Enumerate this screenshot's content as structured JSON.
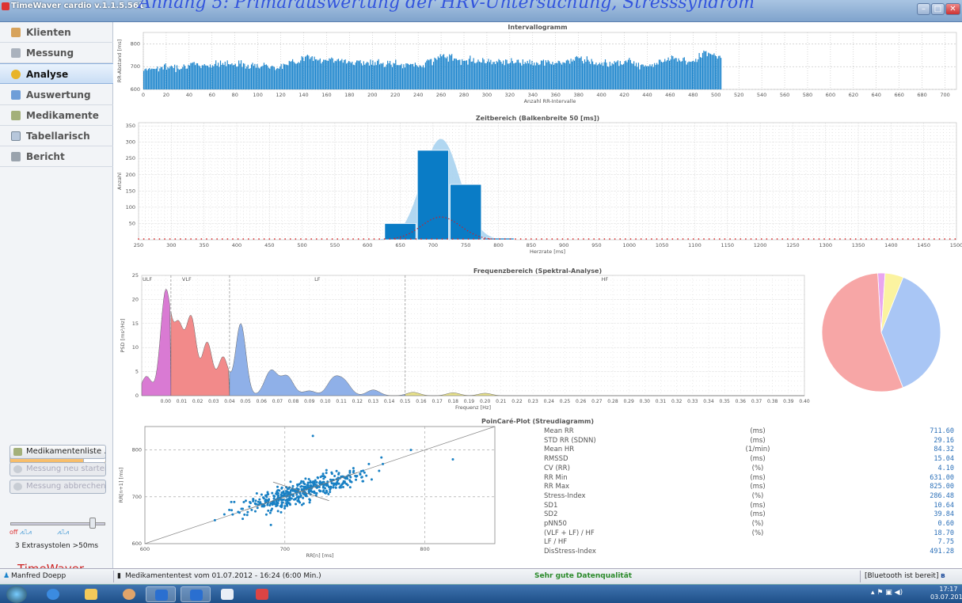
{
  "window": {
    "title": "TimeWaver cardio v.1.1.5.561",
    "caption": "Anhang 5: Primärauswertung der HRV-Untersuchung, Stresssyndrom"
  },
  "nav": {
    "items": [
      {
        "label": "Klienten"
      },
      {
        "label": "Messung"
      },
      {
        "label": "Analyse",
        "active": true
      },
      {
        "label": "Auswertung"
      },
      {
        "label": "Medikamente"
      },
      {
        "label": "Tabellarisch"
      },
      {
        "label": "Bericht"
      }
    ]
  },
  "sidebar": {
    "medtest_label": "Medikamententest",
    "medlist_label": "Medikamentenliste ...",
    "restart_label": "Messung neu starten",
    "abort_label": "Messung abbrechen",
    "ecg_off": "off",
    "extrasystolen": "3 Extrasystolen >50ms",
    "logo_text": "TimeWaver",
    "logo_sub": "cardio"
  },
  "charts": {
    "interval": {
      "title": "Intervallogramm",
      "ylabel": "RR-Abstand [ms]",
      "xlabel": "Anzahl RR-Intervalle",
      "yticks": [
        "800",
        "700",
        "600"
      ],
      "xticks": [
        "0",
        "20",
        "40",
        "60",
        "80",
        "100",
        "120",
        "140",
        "160",
        "180",
        "200",
        "220",
        "240",
        "260",
        "280",
        "300",
        "320",
        "340",
        "360",
        "380",
        "400",
        "420",
        "440",
        "460",
        "480",
        "500",
        "520",
        "540",
        "560",
        "580",
        "600",
        "620",
        "640",
        "660",
        "680",
        "700"
      ]
    },
    "histogram": {
      "title": "Zeitbereich (Balkenbreite 50 [ms])",
      "ylabel": "Anzahl",
      "xlabel": "Herzrate [ms]",
      "yticks": [
        "350",
        "300",
        "250",
        "200",
        "150",
        "100",
        "50"
      ],
      "xticks": [
        "250",
        "300",
        "350",
        "400",
        "450",
        "500",
        "550",
        "600",
        "650",
        "700",
        "750",
        "800",
        "850",
        "900",
        "950",
        "1000",
        "1050",
        "1100",
        "1150",
        "1200",
        "1250",
        "1300",
        "1350",
        "1400",
        "1450",
        "1500"
      ]
    },
    "spectral": {
      "title": "Frequenzbereich (Spektral-Analyse)",
      "ylabel": "PSD [ms²/Hz]",
      "xlabel": "Frequenz [Hz]",
      "band_labels": [
        "ULF",
        "VLF",
        "LF",
        "HF"
      ],
      "yticks": [
        "25",
        "20",
        "15",
        "10",
        "5",
        "0"
      ],
      "xticks": [
        "0.00",
        "0.01",
        "0.02",
        "0.03",
        "0.04",
        "0.05",
        "0.06",
        "0.07",
        "0.08",
        "0.09",
        "0.10",
        "0.11",
        "0.12",
        "0.13",
        "0.14",
        "0.15",
        "0.16",
        "0.17",
        "0.18",
        "0.19",
        "0.20",
        "0.21",
        "0.22",
        "0.23",
        "0.24",
        "0.25",
        "0.26",
        "0.27",
        "0.28",
        "0.29",
        "0.30",
        "0.31",
        "0.32",
        "0.33",
        "0.34",
        "0.35",
        "0.36",
        "0.37",
        "0.38",
        "0.39",
        "0.40"
      ]
    },
    "poincare": {
      "title": "PoinCaré-Plot (Streudiagramm)",
      "ylabel": "RR[n+1] [ms]",
      "xlabel": "RR[n] [ms]",
      "xticks": [
        "600",
        "700",
        "800"
      ],
      "yticks": [
        "800",
        "700",
        "600"
      ]
    }
  },
  "chart_data": [
    {
      "type": "bar",
      "title": "Intervallogramm",
      "xlabel": "Anzahl RR-Intervalle",
      "ylabel": "RR-Abstand [ms]",
      "xlim": [
        0,
        710
      ],
      "ylim": [
        600,
        850
      ],
      "count": 505,
      "envelope": {
        "x": [
          0,
          40,
          80,
          100,
          120,
          140,
          160,
          200,
          240,
          260,
          280,
          300,
          340,
          360,
          380,
          400,
          420,
          440,
          460,
          480,
          490,
          505
        ],
        "y": [
          690,
          705,
          715,
          705,
          700,
          740,
          730,
          715,
          705,
          745,
          730,
          725,
          720,
          715,
          735,
          710,
          725,
          705,
          735,
          720,
          765,
          735
        ]
      }
    },
    {
      "type": "bar",
      "title": "Zeitbereich (Balkenbreite 50 [ms])",
      "xlabel": "Herzrate [ms]",
      "ylabel": "Anzahl",
      "xlim": [
        250,
        1500
      ],
      "ylim": [
        0,
        360
      ],
      "categories": [
        "650",
        "700",
        "750",
        "800"
      ],
      "values": [
        50,
        275,
        170,
        5
      ],
      "bin_width": 50,
      "gaussian": {
        "mean": 712,
        "sd": 29,
        "peak": 310
      },
      "red_curve_peak": 70
    },
    {
      "type": "area",
      "title": "Frequenzbereich (Spektral-Analyse)",
      "xlabel": "Frequenz [Hz]",
      "ylabel": "PSD [ms²/Hz]",
      "xlim": [
        -0.015,
        0.4
      ],
      "ylim": [
        0,
        25
      ],
      "bands": [
        {
          "name": "ULF",
          "range": [
            -0.015,
            0.0033
          ],
          "color": "#d97ad3"
        },
        {
          "name": "VLF",
          "range": [
            0.0033,
            0.04
          ],
          "color": "#f28a8a"
        },
        {
          "name": "LF",
          "range": [
            0.04,
            0.15
          ],
          "color": "#8fb0e8"
        },
        {
          "name": "HF",
          "range": [
            0.15,
            0.4
          ],
          "color": "#e6e08a"
        }
      ],
      "peaks": {
        "x": [
          -0.012,
          0.0,
          0.008,
          0.016,
          0.026,
          0.036,
          0.047,
          0.066,
          0.076,
          0.09,
          0.105,
          0.112,
          0.13,
          0.155,
          0.18,
          0.2
        ],
        "y": [
          4,
          21.5,
          14,
          16,
          11,
          8,
          15,
          5.2,
          4,
          1,
          3.3,
          2.7,
          1.2,
          0.7,
          0.6,
          0.5
        ]
      }
    },
    {
      "type": "pie",
      "values": [
        55,
        38,
        5,
        2
      ],
      "colors": [
        "#f7a6a6",
        "#a9c6f5",
        "#fbf3a0",
        "#e9a6f0"
      ]
    },
    {
      "type": "scatter",
      "title": "PoinCaré-Plot (Streudiagramm)",
      "xlabel": "RR[n] [ms]",
      "ylabel": "RR[n+1] [ms]",
      "xlim": [
        600,
        850
      ],
      "ylim": [
        600,
        850
      ],
      "mean": 711.6,
      "sd1": 10.64,
      "sd2": 39.84,
      "outliers": {
        "x": [
          650,
          690,
          700,
          720,
          760,
          770,
          790,
          820,
          730,
          740
        ],
        "y": [
          650,
          640,
          680,
          830,
          770,
          770,
          800,
          780,
          710,
          720
        ]
      }
    }
  ],
  "stats": [
    {
      "name": "Mean RR",
      "unit": "(ms)",
      "value": "711.60"
    },
    {
      "name": "STD RR (SDNN)",
      "unit": "(ms)",
      "value": "29.16"
    },
    {
      "name": "Mean HR",
      "unit": "(1/min)",
      "value": "84.32"
    },
    {
      "name": "RMSSD",
      "unit": "(ms)",
      "value": "15.04"
    },
    {
      "name": "CV (RR)",
      "unit": "(%)",
      "value": "4.10"
    },
    {
      "name": "RR Min",
      "unit": "(ms)",
      "value": "631.00"
    },
    {
      "name": "RR Max",
      "unit": "(ms)",
      "value": "825.00"
    },
    {
      "name": "Stress-Index",
      "unit": "(%)",
      "value": "286.48"
    },
    {
      "name": "SD1",
      "unit": "(ms)",
      "value": "10.64"
    },
    {
      "name": "SD2",
      "unit": "(ms)",
      "value": "39.84"
    },
    {
      "name": "pNN50",
      "unit": "(%)",
      "value": "0.60"
    },
    {
      "name": "(VLF + LF) / HF",
      "unit": "(%)",
      "value": "18.70"
    },
    {
      "name": "LF / HF",
      "unit": "",
      "value": "7.75"
    },
    {
      "name": "DisStress-Index",
      "unit": "",
      "value": "491.28"
    }
  ],
  "status": {
    "user": "Manfred Doepp",
    "session": "Medikamententest vom 01.07.2012 - 16:24  (6:00 Min.)",
    "quality": "Sehr gute Datenqualität",
    "bluetooth": "[Bluetooth ist bereit]"
  },
  "taskbar": {
    "time": "17:17",
    "date": "03.07.2012"
  },
  "colors": {
    "bar": "#1b84cc",
    "grid": "#b0b0b0",
    "quality": "#2a8a2a"
  }
}
